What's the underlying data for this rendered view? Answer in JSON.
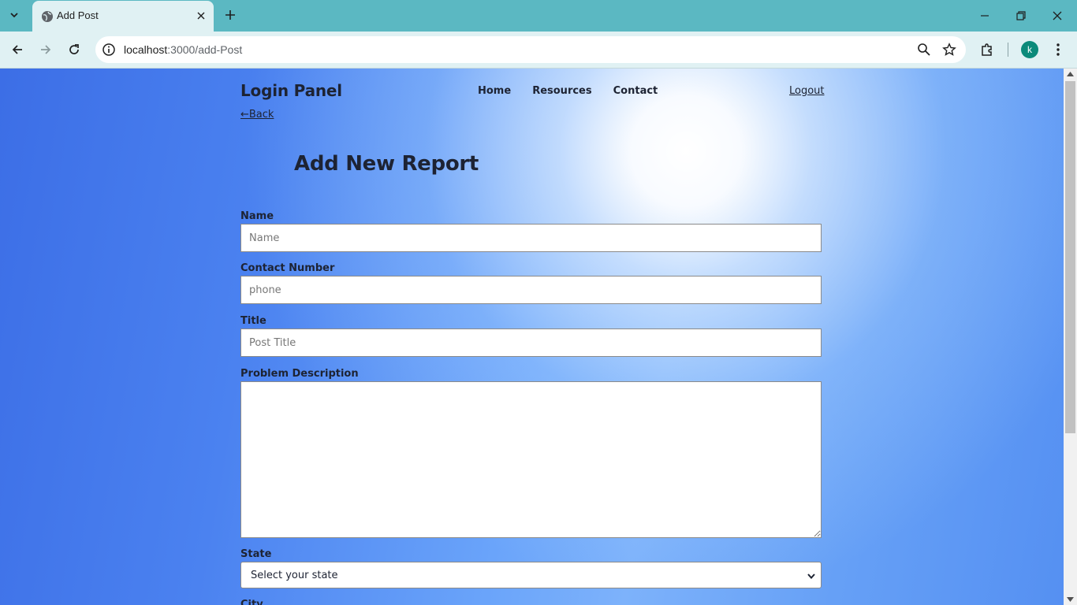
{
  "browser": {
    "tab_title": "Add Post",
    "url_host": "localhost",
    "url_path": ":3000/add-Post",
    "profile_initial": "k"
  },
  "nav": {
    "brand": "Login Panel",
    "links": [
      "Home",
      "Resources",
      "Contact"
    ],
    "logout": "Logout",
    "back": "←Back"
  },
  "form": {
    "title": "Add New Report",
    "name_label": "Name",
    "name_placeholder": "Name",
    "contact_label": "Contact Number",
    "contact_placeholder": "phone",
    "title_label": "Title",
    "title_placeholder": "Post Title",
    "description_label": "Problem Description",
    "state_label": "State",
    "state_selected": "Select your state",
    "city_label": "City"
  }
}
